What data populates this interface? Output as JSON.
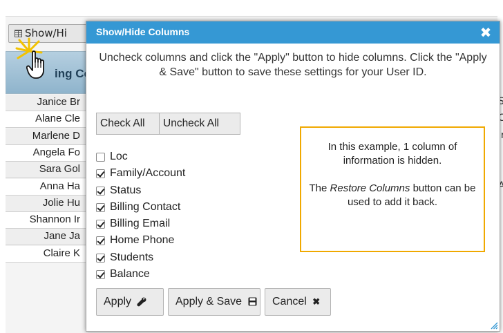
{
  "background": {
    "showhide_button": {
      "label": "Show/Hi",
      "icon": "grid-icon"
    },
    "header_label": "ing Co",
    "rows": [
      {
        "name": "Janice Br",
        "edge": "S"
      },
      {
        "name": "Alane Cle",
        "edge": "C"
      },
      {
        "name": "Marlene D",
        "edge": "ir"
      },
      {
        "name": "Angela Fo",
        "edge": ""
      },
      {
        "name": "Sara Gol",
        "edge": ""
      },
      {
        "name": "Anna Ha",
        "edge": "A"
      },
      {
        "name": "Jolie Hu",
        "edge": ""
      },
      {
        "name": "Shannon Ir",
        "edge": "i"
      },
      {
        "name": "Jane Ja",
        "edge": ""
      },
      {
        "name": "Claire K",
        "edge": ""
      }
    ]
  },
  "modal": {
    "title": "Show/Hide Columns",
    "close_icon": "close-icon",
    "instructions": "Uncheck columns and click the \"Apply\" button to hide columns. Click the \"Apply & Save\" button to save these settings for your User ID.",
    "check_all_label": "Check All",
    "uncheck_all_label": "Uncheck All",
    "columns": [
      {
        "label": "Loc",
        "checked": false
      },
      {
        "label": "Family/Account",
        "checked": true
      },
      {
        "label": "Status",
        "checked": true
      },
      {
        "label": "Billing Contact",
        "checked": true
      },
      {
        "label": "Billing Email",
        "checked": true
      },
      {
        "label": "Home Phone",
        "checked": true
      },
      {
        "label": "Students",
        "checked": true
      },
      {
        "label": "Balance",
        "checked": true
      }
    ],
    "callout": {
      "line1": "In this example, 1 column of information is hidden.",
      "line2_pre": "The ",
      "line2_em": "Restore Columns",
      "line2_post": " button can be used to add it back."
    },
    "apply_label": "Apply",
    "apply_save_label": "Apply & Save",
    "cancel_label": "Cancel"
  },
  "colors": {
    "titlebar": "#3598d4",
    "callout_border": "#f0a900",
    "cursor_sparkle": "#f2c200"
  }
}
